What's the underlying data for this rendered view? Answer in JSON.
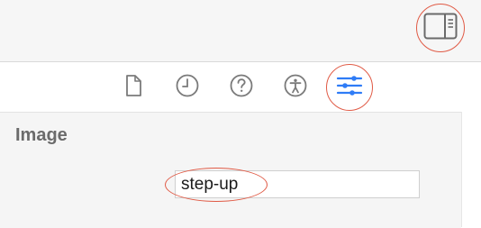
{
  "header": {
    "inspector_toggle_icon": "inspector-panel-icon"
  },
  "inspector_tabs": [
    {
      "id": "file",
      "icon": "document-icon",
      "selected": false
    },
    {
      "id": "history",
      "icon": "clock-icon",
      "selected": false
    },
    {
      "id": "help",
      "icon": "help-icon",
      "selected": false
    },
    {
      "id": "accessibility",
      "icon": "accessibility-icon",
      "selected": false
    },
    {
      "id": "attributes",
      "icon": "sliders-icon",
      "selected": true
    }
  ],
  "attributes": {
    "section_title": "Image",
    "image_value": "step-up"
  },
  "colors": {
    "accent": "#2f7cf6",
    "icon_gray": "#7a7a7a",
    "highlight": "#e05a45"
  }
}
